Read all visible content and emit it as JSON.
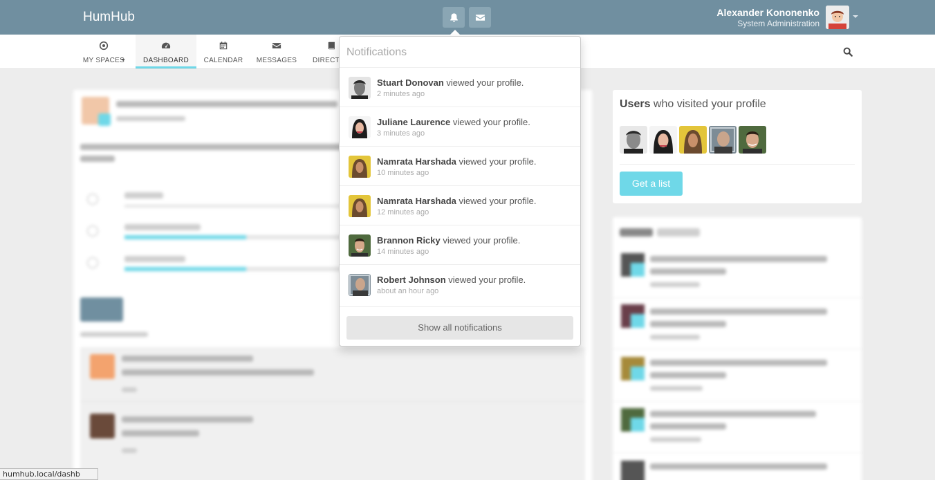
{
  "app": {
    "brand": "HumHub"
  },
  "header": {
    "notifications_icon": "bell-icon",
    "messages_icon": "envelope-icon",
    "user_name": "Alexander Kononenko",
    "user_role": "System Administration"
  },
  "nav": {
    "items": [
      {
        "label": "MY SPACES",
        "icon": "target-icon"
      },
      {
        "label": "DASHBOARD",
        "icon": "dashboard-icon"
      },
      {
        "label": "CALENDAR",
        "icon": "calendar-icon"
      },
      {
        "label": "MESSAGES",
        "icon": "envelope-icon"
      },
      {
        "label": "DIRECTO",
        "icon": "book-icon"
      }
    ],
    "search_icon": "search-icon"
  },
  "notifications": {
    "title": "Notifications",
    "items": [
      {
        "name": "Stuart Donovan",
        "action": " viewed your profile.",
        "time": "2 minutes ago"
      },
      {
        "name": "Juliane Laurence",
        "action": " viewed your profile.",
        "time": "3 minutes ago"
      },
      {
        "name": "Namrata Harshada",
        "action": " viewed your profile.",
        "time": "10 minutes ago"
      },
      {
        "name": "Namrata Harshada",
        "action": " viewed your profile.",
        "time": "12 minutes ago"
      },
      {
        "name": "Brannon Ricky",
        "action": " viewed your profile.",
        "time": "14 minutes ago"
      },
      {
        "name": "Robert Johnson",
        "action": " viewed your profile.",
        "time": "about an hour ago"
      }
    ],
    "show_all": "Show all notifications"
  },
  "visitors": {
    "title_bold": "Users",
    "title_rest": " who visited your profile",
    "button": "Get a list"
  },
  "status_bar": {
    "url": "humhub.local/dashb"
  },
  "colors": {
    "topbar": "#708fa0",
    "accent": "#6fd8e8"
  }
}
